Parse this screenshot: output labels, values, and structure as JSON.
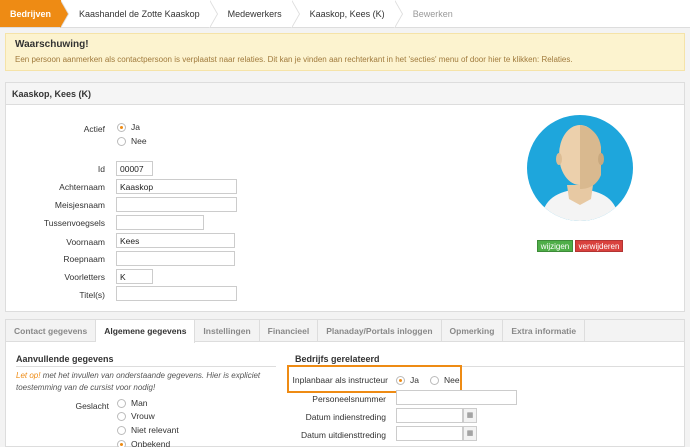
{
  "breadcrumb": [
    "Bedrijven",
    "Kaashandel de Zotte Kaaskop",
    "Medewerkers",
    "Kaaskop, Kees (K)",
    "Bewerken"
  ],
  "warning": {
    "title": "Waarschuwing!",
    "text": "Een persoon aanmerken als contactpersoon is verplaatst naar relaties. Dit kan je vinden aan rechterkant in het 'secties' menu of door hier te klikken: Relaties."
  },
  "person": {
    "header": "Kaaskop, Kees (K)",
    "actief_label": "Actief",
    "actief_options": [
      "Ja",
      "Nee"
    ],
    "actief_selected": "Ja",
    "fields": {
      "id": {
        "label": "Id",
        "value": "00007"
      },
      "achternaam": {
        "label": "Achternaam",
        "value": "Kaaskop"
      },
      "meisjesnaam": {
        "label": "Meisjesnaam",
        "value": ""
      },
      "tussenvoegsels": {
        "label": "Tussenvoegsels",
        "value": ""
      },
      "voornaam": {
        "label": "Voornaam",
        "value": "Kees"
      },
      "roepnaam": {
        "label": "Roepnaam",
        "value": ""
      },
      "voorletters": {
        "label": "Voorletters",
        "value": "K"
      },
      "titels": {
        "label": "Titel(s)",
        "value": ""
      }
    },
    "photo_buttons": {
      "change": "wijzigen",
      "delete": "verwijderen"
    }
  },
  "tabs": [
    "Contact gegevens",
    "Algemene gegevens",
    "Instellingen",
    "Financieel",
    "Planaday/Portals inloggen",
    "Opmerking",
    "Extra informatie"
  ],
  "active_tab": "Algemene gegevens",
  "extra": {
    "title": "Aanvullende gegevens",
    "note_accent": "Let op!",
    "note_rest": " met het invullen van onderstaande gegevens. Hier is expliciet toestemming van de cursist voor nodig!",
    "geslacht_label": "Geslacht",
    "geslacht_options": [
      "Man",
      "Vrouw",
      "Niet relevant",
      "Onbekend"
    ],
    "geslacht_selected": "Onbekend"
  },
  "company": {
    "title": "Bedrijfs gerelateerd",
    "instructeur_label": "Inplanbaar als instructeur",
    "instructeur_options": [
      "Ja",
      "Nee"
    ],
    "instructeur_selected": "Ja",
    "personeelsnummer_label": "Personeelsnummer",
    "datum_in_label": "Datum indienstreding",
    "datum_uit_label": "Datum uitdiensttreding"
  },
  "colors": {
    "accent": "#ee8b14",
    "avatar_bg": "#1ea6dc",
    "btn_green": "#4fae48",
    "btn_red": "#d9413d"
  }
}
